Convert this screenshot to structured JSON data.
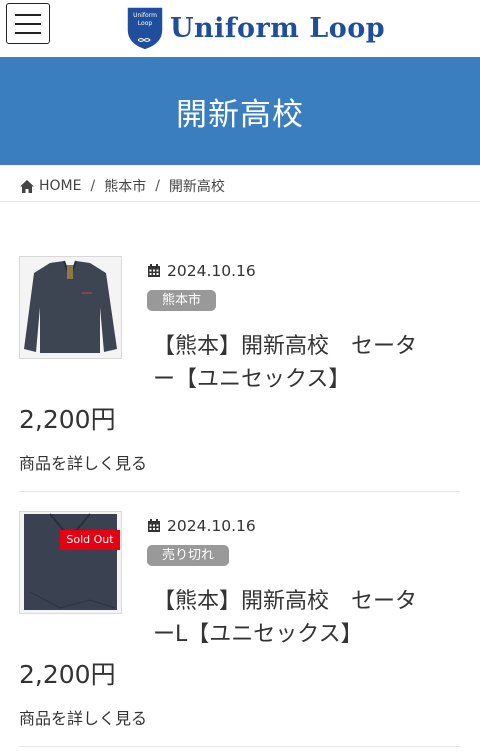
{
  "header": {
    "brand": "Uniform Loop",
    "emblem_text": [
      "Uniform",
      "Loop"
    ],
    "menu_icon": "hamburger-icon"
  },
  "page": {
    "title": "開新高校"
  },
  "breadcrumb": {
    "home": "HOME",
    "separator": "/",
    "city": "熊本市",
    "current": "開新高校"
  },
  "products": [
    {
      "date": "2024.10.16",
      "tag": "熊本市",
      "title_line1": "【熊本】開新高校　セータ",
      "title_line2": "ー【ユニセックス】",
      "price": "2,200円",
      "link": "商品を詳しく見る",
      "sold_out": false
    },
    {
      "date": "2024.10.16",
      "tag": "売り切れ",
      "title_line1": "【熊本】開新高校　セータ",
      "title_line2": "ーL【ユニセックス】",
      "price": "2,200円",
      "link": "商品を詳しく見る",
      "sold_out": true,
      "sold_label": "Sold Out"
    }
  ],
  "colors": {
    "banner": "#3a7ec0",
    "brand": "#1f4f9c",
    "tag": "#999999",
    "sold": "#e60012"
  }
}
